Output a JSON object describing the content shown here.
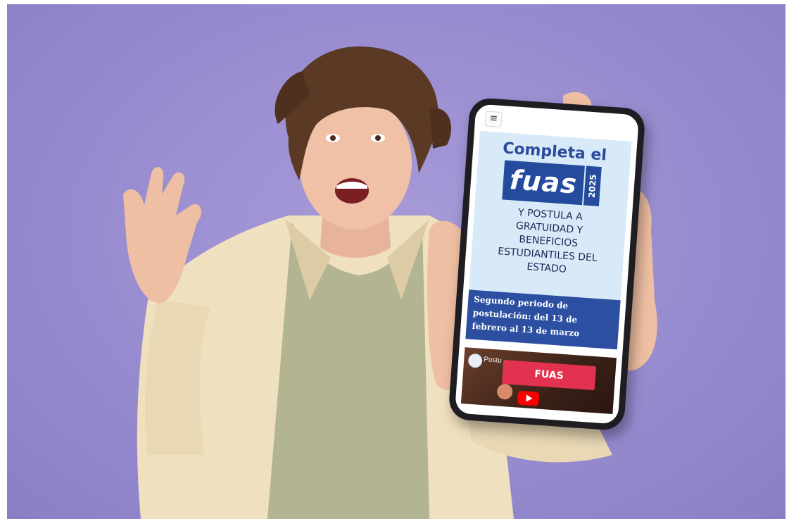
{
  "phone_screen": {
    "menu_icon": "≡",
    "hero": {
      "title": "Completa el",
      "logo_word": "fuas",
      "logo_year": "2025",
      "subtitle": "Y POSTULA A GRATUIDAD Y BENEFICIOS ESTUDIANTILES DEL ESTADO"
    },
    "period_text": "Segundo periodo de postulación: del 13 de febrero al 13 de marzo",
    "video": {
      "title": "Postu",
      "button_label": "FUAS"
    }
  },
  "colors": {
    "background": "#9b8fd2",
    "brand_blue": "#254b9d",
    "hero_bg": "#d8eaf8",
    "accent_red": "#e3324f"
  }
}
